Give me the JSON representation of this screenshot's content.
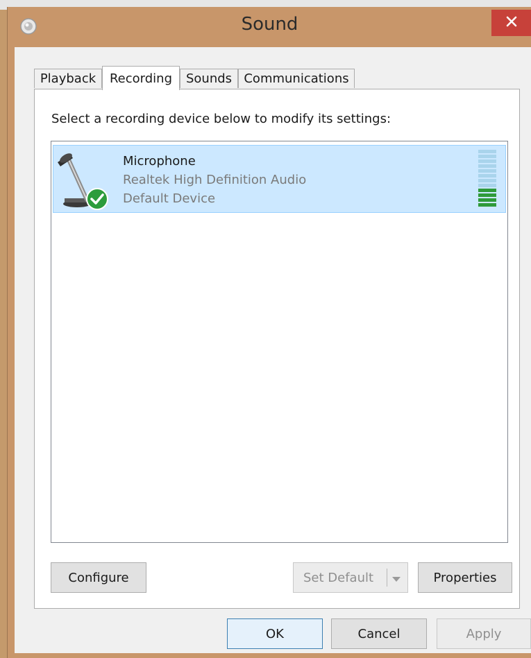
{
  "window": {
    "title": "Sound",
    "icons": {
      "app": "speaker-icon",
      "close": "close-icon"
    }
  },
  "tabs": [
    {
      "label": "Playback",
      "active": false
    },
    {
      "label": "Recording",
      "active": true
    },
    {
      "label": "Sounds",
      "active": false
    },
    {
      "label": "Communications",
      "active": false
    }
  ],
  "panel": {
    "instruction": "Select a recording device below to modify its settings:"
  },
  "devices": [
    {
      "name": "Microphone",
      "driver": "Realtek High Definition Audio",
      "status": "Default Device",
      "icon": "microphone-icon",
      "badge": "default-checkmark-icon",
      "selected": true,
      "level_fraction": 0.33
    }
  ],
  "panel_buttons": {
    "configure": "Configure",
    "set_default": "Set Default",
    "properties": "Properties"
  },
  "dialog_buttons": {
    "ok": "OK",
    "cancel": "Cancel",
    "apply": "Apply"
  },
  "colors": {
    "titlebar": "#c8966a",
    "close": "#c7413a",
    "selection": "#cce8ff",
    "selection_border": "#99d1ff",
    "level_active": "#2e9a3a",
    "level_inactive": "#a9d4ec"
  }
}
